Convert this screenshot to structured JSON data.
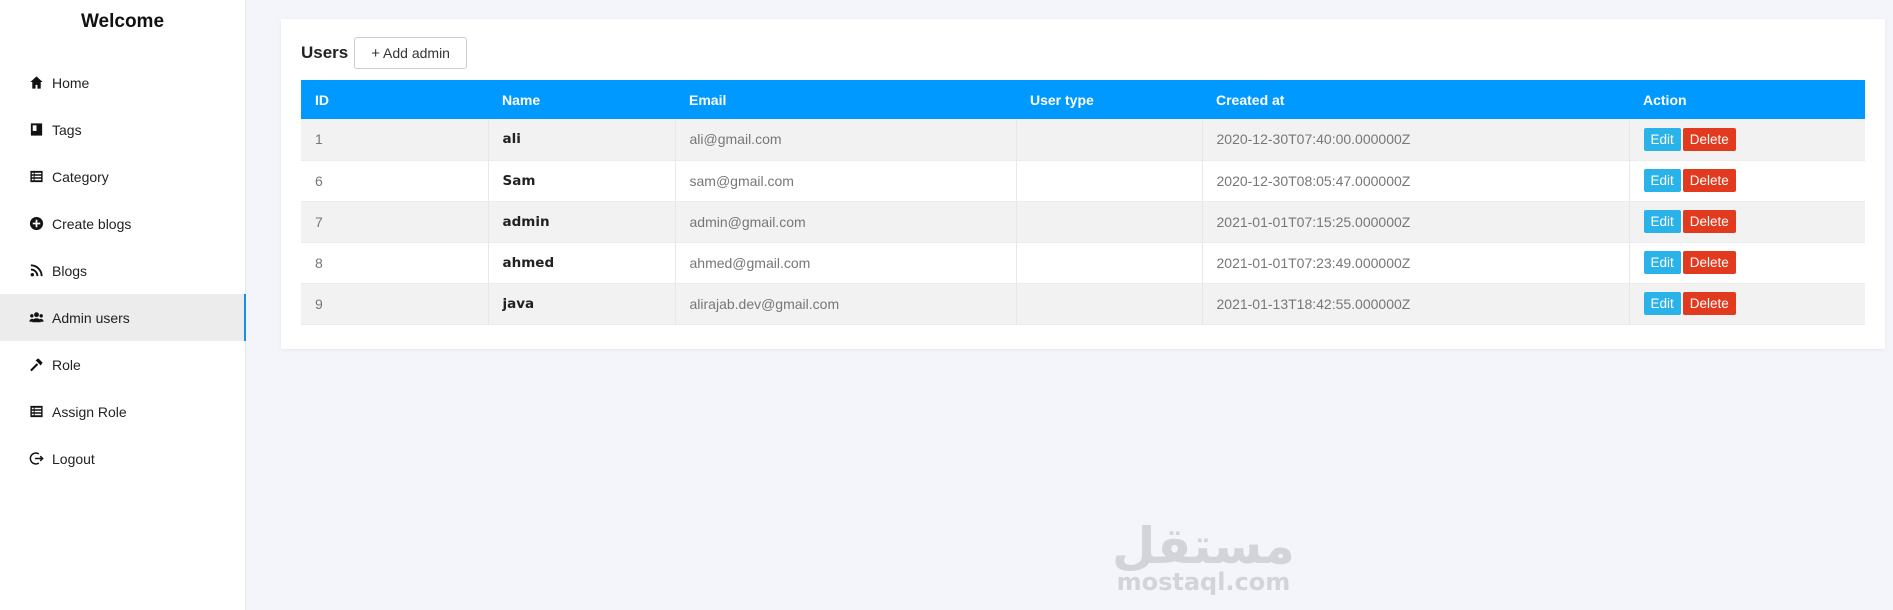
{
  "sidebar": {
    "title": "Welcome",
    "items": [
      {
        "label": "Home",
        "icon": "home-icon"
      },
      {
        "label": "Tags",
        "icon": "book-icon"
      },
      {
        "label": "Category",
        "icon": "list-icon"
      },
      {
        "label": "Create blogs",
        "icon": "plus-circle-icon"
      },
      {
        "label": "Blogs",
        "icon": "rss-icon"
      },
      {
        "label": "Admin users",
        "icon": "users-icon",
        "active": true
      },
      {
        "label": "Role",
        "icon": "hammer-icon"
      },
      {
        "label": "Assign Role",
        "icon": "list-icon"
      },
      {
        "label": "Logout",
        "icon": "logout-icon"
      }
    ]
  },
  "users_card": {
    "title": "Users",
    "add_button": "Add admin",
    "add_icon": "+",
    "columns": [
      "ID",
      "Name",
      "Email",
      "User type",
      "Created at",
      "Action"
    ],
    "rows": [
      {
        "id": "1",
        "name": "ali",
        "email": "ali@gmail.com",
        "user_type": "",
        "created_at": "2020-12-30T07:40:00.000000Z"
      },
      {
        "id": "6",
        "name": "Sam",
        "email": "sam@gmail.com",
        "user_type": "",
        "created_at": "2020-12-30T08:05:47.000000Z"
      },
      {
        "id": "7",
        "name": "admin",
        "email": "admin@gmail.com",
        "user_type": "",
        "created_at": "2021-01-01T07:15:25.000000Z"
      },
      {
        "id": "8",
        "name": "ahmed",
        "email": "ahmed@gmail.com",
        "user_type": "",
        "created_at": "2021-01-01T07:23:49.000000Z"
      },
      {
        "id": "9",
        "name": "java",
        "email": "alirajab.dev@gmail.com",
        "user_type": "",
        "created_at": "2021-01-13T18:42:55.000000Z"
      }
    ],
    "edit_label": "Edit",
    "delete_label": "Delete"
  },
  "watermark": {
    "arabic": "مستقل",
    "latin": "mostaql.com"
  },
  "colors": {
    "header": "#0099ff",
    "edit": "#2ab3e8",
    "delete": "#e23a1e",
    "active_bar": "#1a8ee0"
  }
}
